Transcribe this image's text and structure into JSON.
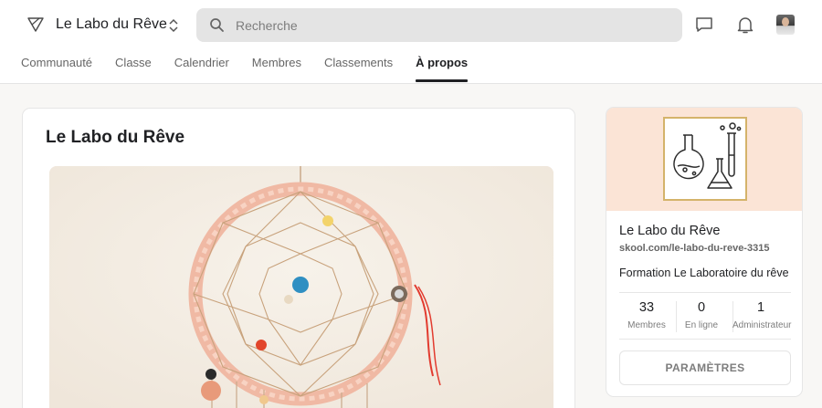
{
  "header": {
    "brand": "Le Labo du Rêve",
    "search_placeholder": "Recherche",
    "icons": [
      "triangle-logo-icon",
      "chevron-updown-icon",
      "search-icon",
      "chat-icon",
      "bell-icon",
      "avatar"
    ]
  },
  "tabs": [
    {
      "label": "Communauté",
      "active": false
    },
    {
      "label": "Classe",
      "active": false
    },
    {
      "label": "Calendrier",
      "active": false
    },
    {
      "label": "Membres",
      "active": false
    },
    {
      "label": "Classements",
      "active": false
    },
    {
      "label": "À propos",
      "active": true
    }
  ],
  "main": {
    "title": "Le Labo du Rêve"
  },
  "side": {
    "name": "Le Labo du Rêve",
    "url": "skool.com/le-labo-du-reve-3315",
    "description": "Formation Le Laboratoire du rêve",
    "stats": [
      {
        "value": "33",
        "label": "Membres"
      },
      {
        "value": "0",
        "label": "En ligne"
      },
      {
        "value": "1",
        "label": "Administrateur"
      }
    ],
    "settings_label": "PARAMÈTRES"
  },
  "colors": {
    "accent": "#202124",
    "cover_bg": "#fbe4d6",
    "logo_border": "#d4b36a",
    "search_bg": "#e4e4e4",
    "page_bg": "#f8f7f5"
  }
}
